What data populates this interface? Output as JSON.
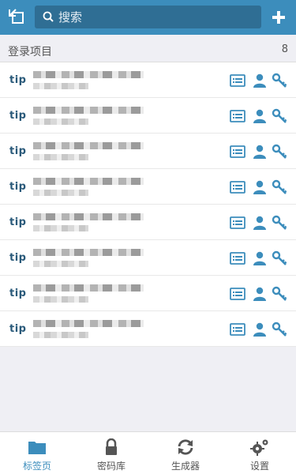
{
  "colors": {
    "accent": "#3c8dbc",
    "search_bg": "#2f6e94",
    "icon": "#3c8dbc"
  },
  "topbar": {
    "back_icon": "back-arrow-icon",
    "search_placeholder": "搜索",
    "add_icon": "plus-icon"
  },
  "section": {
    "title": "登录项目",
    "count": "8"
  },
  "items": [
    {
      "favicon": "tip"
    },
    {
      "favicon": "tip"
    },
    {
      "favicon": "tip"
    },
    {
      "favicon": "tip"
    },
    {
      "favicon": "tip"
    },
    {
      "favicon": "tip"
    },
    {
      "favicon": "tip"
    },
    {
      "favicon": "tip"
    }
  ],
  "tabs": [
    {
      "label": "标签页",
      "icon": "folder-icon",
      "active": true
    },
    {
      "label": "密码库",
      "icon": "lock-icon",
      "active": false
    },
    {
      "label": "生成器",
      "icon": "refresh-icon",
      "active": false
    },
    {
      "label": "设置",
      "icon": "gear-icon",
      "active": false
    }
  ]
}
